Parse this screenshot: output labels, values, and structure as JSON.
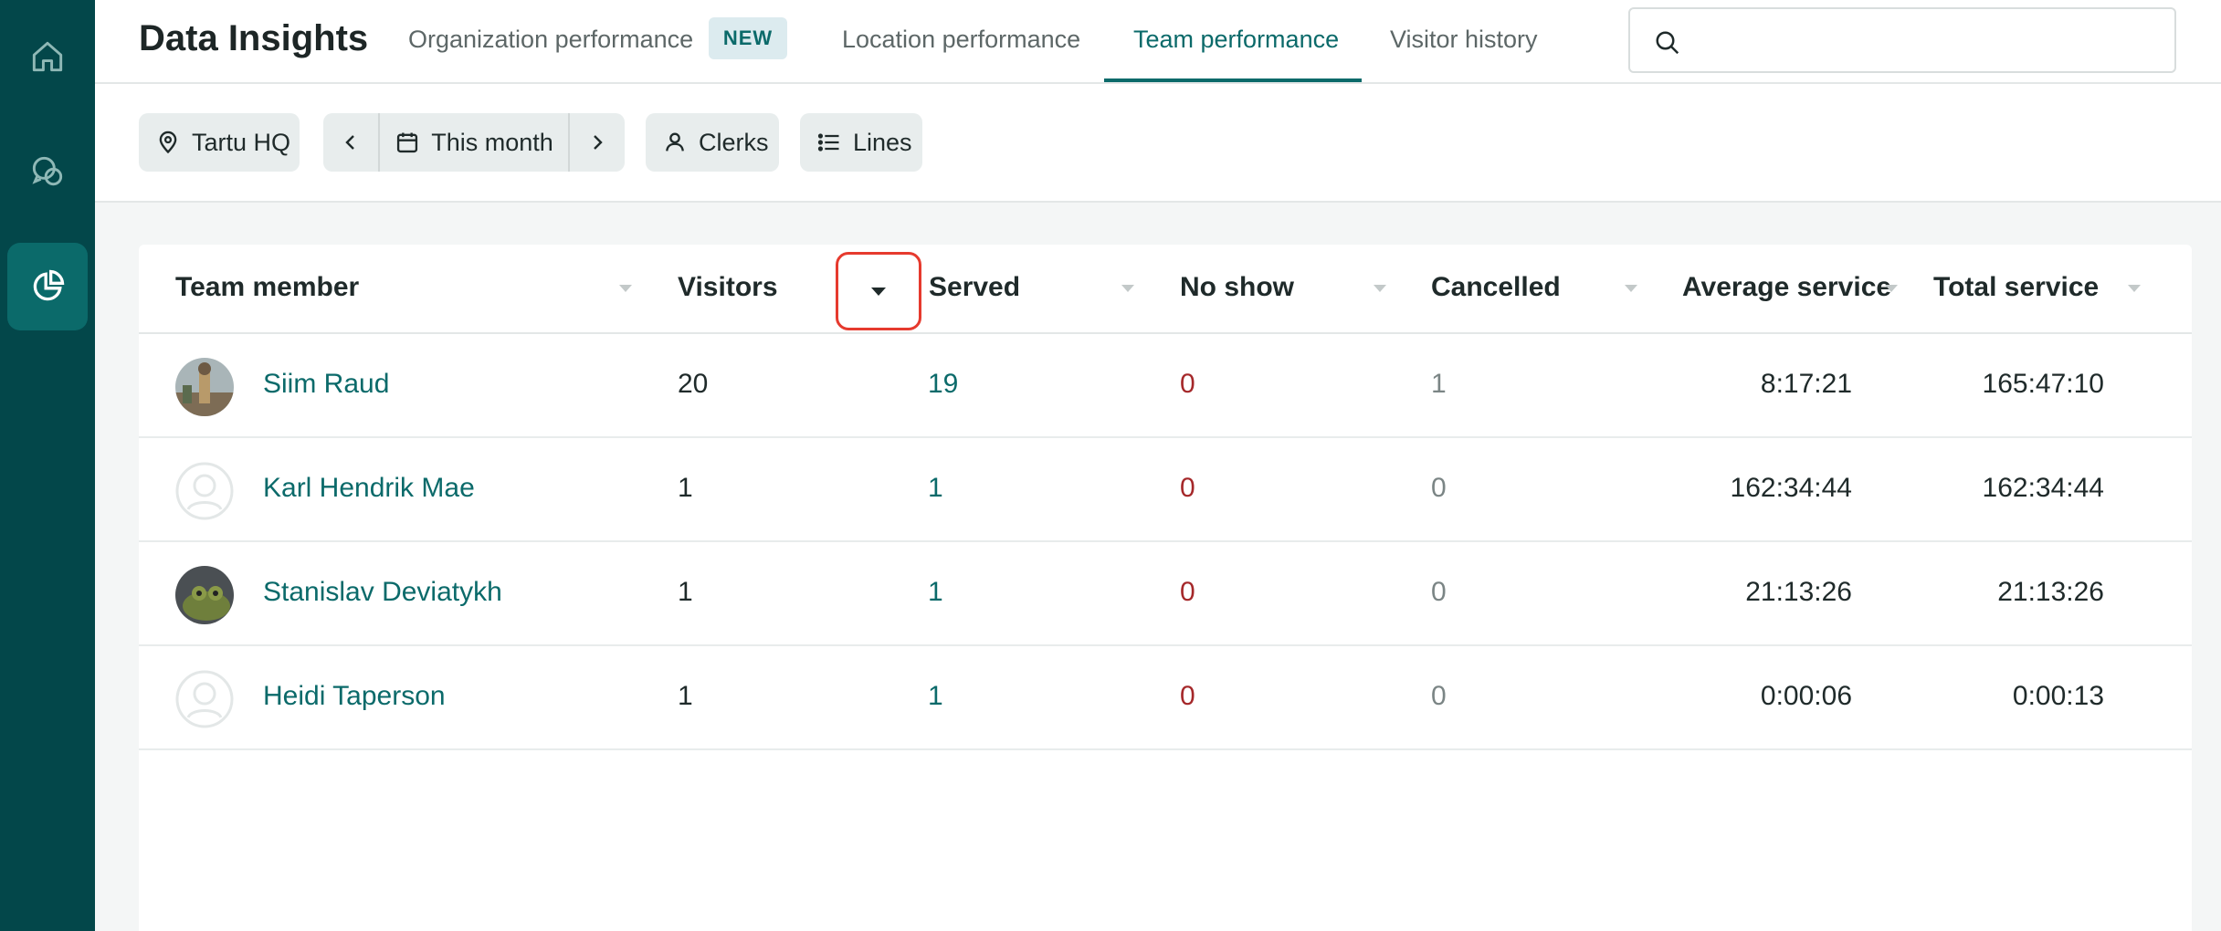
{
  "app": {
    "title": "Data Insights"
  },
  "sidebar": {
    "items": [
      {
        "icon": "home-icon"
      },
      {
        "icon": "chat-bubbles-icon"
      },
      {
        "icon": "pie-chart-icon",
        "active": true
      }
    ]
  },
  "tabs": [
    {
      "label": "Organization performance",
      "badge": "NEW"
    },
    {
      "label": "Location performance"
    },
    {
      "label": "Team performance",
      "active": true
    },
    {
      "label": "Visitor history"
    }
  ],
  "search": {
    "value": "",
    "placeholder": ""
  },
  "filters": {
    "location": "Tartu HQ",
    "period": "This month",
    "role": "Clerks",
    "view": "Lines"
  },
  "table": {
    "columns": [
      "Team member",
      "Visitors",
      "Served",
      "No show",
      "Cancelled",
      "Average service",
      "Total service"
    ],
    "rows": [
      {
        "name": "Siim Raud",
        "visitors": "20",
        "served": "19",
        "no_show": "0",
        "cancelled": "1",
        "average_service": "8:17:21",
        "total_service": "165:47:10",
        "avatar": "photo"
      },
      {
        "name": "Karl Hendrik Mae",
        "visitors": "1",
        "served": "1",
        "no_show": "0",
        "cancelled": "0",
        "average_service": "162:34:44",
        "total_service": "162:34:44",
        "avatar": "placeholder"
      },
      {
        "name": "Stanislav Deviatykh",
        "visitors": "1",
        "served": "1",
        "no_show": "0",
        "cancelled": "0",
        "average_service": "21:13:26",
        "total_service": "21:13:26",
        "avatar": "frog"
      },
      {
        "name": "Heidi Taperson",
        "visitors": "1",
        "served": "1",
        "no_show": "0",
        "cancelled": "0",
        "average_service": "0:00:06",
        "total_service": "0:00:13",
        "avatar": "placeholder"
      }
    ]
  },
  "colors": {
    "sidebar": "#03474a",
    "accent": "#0b6a6a",
    "no_show": "#a5282a",
    "highlight_box": "#e63a2e"
  }
}
